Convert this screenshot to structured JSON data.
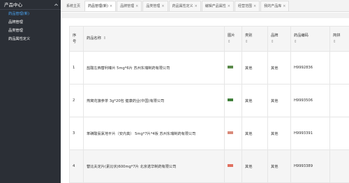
{
  "sidebar": {
    "title": "产品中心",
    "items": [
      {
        "label": "药品管理(新)",
        "active": true
      },
      {
        "label": "品牌管理",
        "active": false
      },
      {
        "label": "品类管理",
        "active": false
      },
      {
        "label": "药品属性定义",
        "active": false
      }
    ]
  },
  "tabs": [
    {
      "label": "系统主页",
      "closable": false,
      "active": false
    },
    {
      "label": "药品管理(新)",
      "closable": true,
      "active": true
    },
    {
      "label": "品牌管理",
      "closable": true,
      "active": false
    },
    {
      "label": "品类管理",
      "closable": true,
      "active": false
    },
    {
      "label": "药品属性定义",
      "closable": true,
      "active": false
    },
    {
      "label": "编辑产品属性",
      "closable": true,
      "active": false
    },
    {
      "label": "经营范围",
      "closable": true,
      "active": false
    },
    {
      "label": "我的产品库",
      "closable": true,
      "active": false
    }
  ],
  "table": {
    "headers": {
      "seq_line1": "序",
      "seq_line2": "号",
      "name": "药品名称",
      "image": "图片",
      "category": "类别",
      "brand": "品牌",
      "code": "药品编码",
      "extra": "简拼"
    },
    "rows": [
      {
        "seq": "1",
        "name": "盐酸左西替利嗪片 5mg*6片 苏州东瑞制药有限公司",
        "category": "其他",
        "brand": "其他",
        "code": "H9992836",
        "thumb_color": "#5a8a4a"
      },
      {
        "seq": "2",
        "name": "燕窝花旗参茶 3g*20包 健康药业(中国)有限公司",
        "category": "其他",
        "brand": "其他",
        "code": "H9993506",
        "thumb_color": "#3f7f3a"
      },
      {
        "seq": "3",
        "name": "苯磺酸氨氯地平片（安内真） 5mg*7片*4板 苏州东瑞制药有限公司",
        "category": "其他",
        "brand": "其他",
        "code": "H9993391",
        "thumb_color": "#d98a7a"
      },
      {
        "seq": "4",
        "name": "替比夫定片(素比伏)600mg*7片 北京诺华制药有限公司",
        "category": "其他",
        "brand": "其他",
        "code": "H9993389",
        "thumb_color": "#e07060"
      }
    ]
  }
}
